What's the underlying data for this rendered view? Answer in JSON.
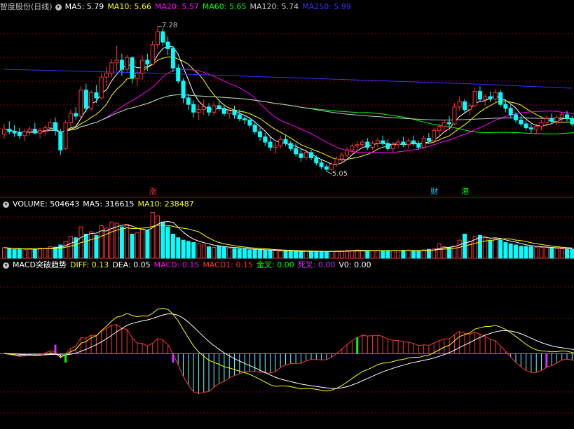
{
  "price_header": {
    "stock": "智度股份(日线)",
    "items": [
      {
        "label": "MA5: 5.79",
        "color": "#ffffff"
      },
      {
        "label": "MA10: 5.66",
        "color": "#ffff00"
      },
      {
        "label": "MA20: 5.57",
        "color": "#ff00ff"
      },
      {
        "label": "MA60: 5.65",
        "color": "#00ff00"
      },
      {
        "label": "MA120: 5.74",
        "color": "#c8c8c8"
      },
      {
        "label": "MA250: 5.99",
        "color": "#3333ff"
      }
    ]
  },
  "volume_header": {
    "items": [
      {
        "label": "VOLUME: 504643",
        "color": "#ffffff"
      },
      {
        "label": "MA5: 316615",
        "color": "#ffffff"
      },
      {
        "label": "MA10: 238487",
        "color": "#ffff00"
      }
    ]
  },
  "macd_header": {
    "name": "MACD突破趋势",
    "items": [
      {
        "label": "DIFF: 0.13",
        "color": "#ffff00"
      },
      {
        "label": "DEA: 0.05",
        "color": "#ffffff"
      },
      {
        "label": "MACD: 0.15",
        "color": "#ff00ff"
      },
      {
        "label": "MACD1: 0.15",
        "color": "#ff3333"
      },
      {
        "label": "金叉: 0.00",
        "color": "#00ff00"
      },
      {
        "label": "死叉: 0.00",
        "color": "#cc33ff"
      },
      {
        "label": "V0: 0.00",
        "color": "#ffffff"
      }
    ]
  },
  "annotations": {
    "high": "7.28",
    "low": "5.05"
  },
  "events": [
    {
      "label": "涨",
      "color": "#ff3333",
      "index": 29
    },
    {
      "label": "财",
      "color": "#00ccff",
      "index": 84
    },
    {
      "label": "港",
      "color": "#00ff00",
      "index": 90
    }
  ],
  "colors": {
    "up": "#ff3333",
    "down": "#00ffff",
    "grid": "#8b0000",
    "ma250": "#3333ff"
  },
  "chart_data": [
    {
      "type": "candlestick",
      "panel": "price",
      "ylim": [
        4.8,
        7.45
      ],
      "grid": true,
      "candles": [
        {
          "o": 5.62,
          "h": 5.78,
          "l": 5.55,
          "c": 5.7
        },
        {
          "o": 5.7,
          "h": 5.82,
          "l": 5.62,
          "c": 5.66
        },
        {
          "o": 5.66,
          "h": 5.76,
          "l": 5.58,
          "c": 5.64
        },
        {
          "o": 5.64,
          "h": 5.72,
          "l": 5.55,
          "c": 5.6
        },
        {
          "o": 5.6,
          "h": 5.7,
          "l": 5.52,
          "c": 5.66
        },
        {
          "o": 5.66,
          "h": 5.74,
          "l": 5.6,
          "c": 5.7
        },
        {
          "o": 5.7,
          "h": 5.8,
          "l": 5.62,
          "c": 5.64
        },
        {
          "o": 5.64,
          "h": 5.72,
          "l": 5.56,
          "c": 5.68
        },
        {
          "o": 5.68,
          "h": 5.76,
          "l": 5.6,
          "c": 5.72
        },
        {
          "o": 5.72,
          "h": 5.86,
          "l": 5.66,
          "c": 5.8
        },
        {
          "o": 5.8,
          "h": 5.88,
          "l": 5.6,
          "c": 5.68
        },
        {
          "o": 5.66,
          "h": 5.7,
          "l": 5.3,
          "c": 5.38
        },
        {
          "o": 5.4,
          "h": 5.84,
          "l": 5.38,
          "c": 5.8
        },
        {
          "o": 5.8,
          "h": 6.0,
          "l": 5.74,
          "c": 5.94
        },
        {
          "o": 5.94,
          "h": 6.04,
          "l": 5.84,
          "c": 5.9
        },
        {
          "o": 5.9,
          "h": 6.36,
          "l": 5.88,
          "c": 6.3
        },
        {
          "o": 6.3,
          "h": 6.4,
          "l": 5.96,
          "c": 6.02
        },
        {
          "o": 6.02,
          "h": 6.3,
          "l": 5.98,
          "c": 6.26
        },
        {
          "o": 6.26,
          "h": 6.38,
          "l": 6.1,
          "c": 6.18
        },
        {
          "o": 6.18,
          "h": 6.56,
          "l": 6.16,
          "c": 6.5
        },
        {
          "o": 6.5,
          "h": 6.66,
          "l": 6.36,
          "c": 6.56
        },
        {
          "o": 6.56,
          "h": 6.78,
          "l": 6.5,
          "c": 6.72
        },
        {
          "o": 6.72,
          "h": 6.98,
          "l": 6.6,
          "c": 6.76
        },
        {
          "o": 6.76,
          "h": 6.86,
          "l": 6.52,
          "c": 6.62
        },
        {
          "o": 6.62,
          "h": 6.84,
          "l": 6.58,
          "c": 6.8
        },
        {
          "o": 6.8,
          "h": 6.82,
          "l": 6.4,
          "c": 6.48
        },
        {
          "o": 6.48,
          "h": 6.62,
          "l": 6.36,
          "c": 6.56
        },
        {
          "o": 6.56,
          "h": 6.84,
          "l": 6.46,
          "c": 6.76
        },
        {
          "o": 6.76,
          "h": 6.86,
          "l": 6.6,
          "c": 6.7
        },
        {
          "o": 6.7,
          "h": 7.06,
          "l": 6.68,
          "c": 7.0
        },
        {
          "o": 7.0,
          "h": 7.28,
          "l": 6.94,
          "c": 7.2
        },
        {
          "o": 7.2,
          "h": 7.26,
          "l": 6.98,
          "c": 7.04
        },
        {
          "o": 7.04,
          "h": 7.12,
          "l": 6.84,
          "c": 6.94
        },
        {
          "o": 6.94,
          "h": 6.98,
          "l": 6.58,
          "c": 6.64
        },
        {
          "o": 6.64,
          "h": 6.7,
          "l": 6.4,
          "c": 6.44
        },
        {
          "o": 6.44,
          "h": 6.48,
          "l": 6.1,
          "c": 6.18
        },
        {
          "o": 6.18,
          "h": 6.24,
          "l": 6.0,
          "c": 6.08
        },
        {
          "o": 6.08,
          "h": 6.14,
          "l": 5.88,
          "c": 5.96
        },
        {
          "o": 5.96,
          "h": 6.08,
          "l": 5.84,
          "c": 6.0
        },
        {
          "o": 6.0,
          "h": 6.16,
          "l": 5.92,
          "c": 6.04
        },
        {
          "o": 6.04,
          "h": 6.1,
          "l": 5.9,
          "c": 5.96
        },
        {
          "o": 5.96,
          "h": 6.12,
          "l": 5.9,
          "c": 6.06
        },
        {
          "o": 6.06,
          "h": 6.16,
          "l": 5.98,
          "c": 6.02
        },
        {
          "o": 6.02,
          "h": 6.08,
          "l": 5.9,
          "c": 5.94
        },
        {
          "o": 5.94,
          "h": 6.04,
          "l": 5.86,
          "c": 5.98
        },
        {
          "o": 5.98,
          "h": 6.06,
          "l": 5.86,
          "c": 5.92
        },
        {
          "o": 5.92,
          "h": 6.0,
          "l": 5.82,
          "c": 5.86
        },
        {
          "o": 5.86,
          "h": 5.92,
          "l": 5.78,
          "c": 5.84
        },
        {
          "o": 5.84,
          "h": 5.88,
          "l": 5.72,
          "c": 5.76
        },
        {
          "o": 5.76,
          "h": 5.82,
          "l": 5.62,
          "c": 5.66
        },
        {
          "o": 5.66,
          "h": 5.72,
          "l": 5.52,
          "c": 5.58
        },
        {
          "o": 5.58,
          "h": 5.64,
          "l": 5.44,
          "c": 5.5
        },
        {
          "o": 5.5,
          "h": 5.58,
          "l": 5.36,
          "c": 5.42
        },
        {
          "o": 5.42,
          "h": 5.5,
          "l": 5.32,
          "c": 5.44
        },
        {
          "o": 5.44,
          "h": 5.6,
          "l": 5.4,
          "c": 5.54
        },
        {
          "o": 5.54,
          "h": 5.62,
          "l": 5.44,
          "c": 5.48
        },
        {
          "o": 5.48,
          "h": 5.52,
          "l": 5.36,
          "c": 5.4
        },
        {
          "o": 5.4,
          "h": 5.48,
          "l": 5.28,
          "c": 5.32
        },
        {
          "o": 5.32,
          "h": 5.4,
          "l": 5.2,
          "c": 5.26
        },
        {
          "o": 5.26,
          "h": 5.4,
          "l": 5.22,
          "c": 5.34
        },
        {
          "o": 5.34,
          "h": 5.38,
          "l": 5.22,
          "c": 5.26
        },
        {
          "o": 5.26,
          "h": 5.3,
          "l": 5.14,
          "c": 5.18
        },
        {
          "o": 5.18,
          "h": 5.24,
          "l": 5.08,
          "c": 5.12
        },
        {
          "o": 5.12,
          "h": 5.16,
          "l": 5.05,
          "c": 5.08
        },
        {
          "o": 5.08,
          "h": 5.2,
          "l": 5.06,
          "c": 5.16
        },
        {
          "o": 5.16,
          "h": 5.28,
          "l": 5.12,
          "c": 5.24
        },
        {
          "o": 5.24,
          "h": 5.34,
          "l": 5.18,
          "c": 5.3
        },
        {
          "o": 5.3,
          "h": 5.42,
          "l": 5.26,
          "c": 5.38
        },
        {
          "o": 5.38,
          "h": 5.48,
          "l": 5.32,
          "c": 5.44
        },
        {
          "o": 5.44,
          "h": 5.52,
          "l": 5.36,
          "c": 5.46
        },
        {
          "o": 5.46,
          "h": 5.54,
          "l": 5.4,
          "c": 5.5
        },
        {
          "o": 5.5,
          "h": 5.56,
          "l": 5.38,
          "c": 5.42
        },
        {
          "o": 5.42,
          "h": 5.52,
          "l": 5.38,
          "c": 5.48
        },
        {
          "o": 5.48,
          "h": 5.56,
          "l": 5.42,
          "c": 5.52
        },
        {
          "o": 5.52,
          "h": 5.6,
          "l": 5.44,
          "c": 5.48
        },
        {
          "o": 5.48,
          "h": 5.54,
          "l": 5.36,
          "c": 5.4
        },
        {
          "o": 5.4,
          "h": 5.5,
          "l": 5.34,
          "c": 5.46
        },
        {
          "o": 5.46,
          "h": 5.54,
          "l": 5.4,
          "c": 5.5
        },
        {
          "o": 5.5,
          "h": 5.58,
          "l": 5.42,
          "c": 5.46
        },
        {
          "o": 5.46,
          "h": 5.56,
          "l": 5.4,
          "c": 5.52
        },
        {
          "o": 5.52,
          "h": 5.6,
          "l": 5.44,
          "c": 5.48
        },
        {
          "o": 5.48,
          "h": 5.52,
          "l": 5.38,
          "c": 5.42
        },
        {
          "o": 5.42,
          "h": 5.6,
          "l": 5.4,
          "c": 5.56
        },
        {
          "o": 5.56,
          "h": 5.64,
          "l": 5.48,
          "c": 5.52
        },
        {
          "o": 5.52,
          "h": 5.72,
          "l": 5.5,
          "c": 5.68
        },
        {
          "o": 5.68,
          "h": 5.78,
          "l": 5.6,
          "c": 5.74
        },
        {
          "o": 5.74,
          "h": 5.84,
          "l": 5.66,
          "c": 5.8
        },
        {
          "o": 5.8,
          "h": 5.9,
          "l": 5.72,
          "c": 5.78
        },
        {
          "o": 5.78,
          "h": 6.1,
          "l": 5.76,
          "c": 6.04
        },
        {
          "o": 6.04,
          "h": 6.2,
          "l": 5.98,
          "c": 6.12
        },
        {
          "o": 6.12,
          "h": 6.16,
          "l": 5.96,
          "c": 6.0
        },
        {
          "o": 6.0,
          "h": 6.1,
          "l": 5.92,
          "c": 6.06
        },
        {
          "o": 6.06,
          "h": 6.34,
          "l": 6.04,
          "c": 6.28
        },
        {
          "o": 6.28,
          "h": 6.36,
          "l": 6.12,
          "c": 6.16
        },
        {
          "o": 6.16,
          "h": 6.24,
          "l": 6.06,
          "c": 6.2
        },
        {
          "o": 6.2,
          "h": 6.28,
          "l": 6.12,
          "c": 6.16
        },
        {
          "o": 6.16,
          "h": 6.32,
          "l": 6.1,
          "c": 6.26
        },
        {
          "o": 6.26,
          "h": 6.3,
          "l": 6.04,
          "c": 6.08
        },
        {
          "o": 6.08,
          "h": 6.16,
          "l": 5.96,
          "c": 6.02
        },
        {
          "o": 6.02,
          "h": 6.08,
          "l": 5.88,
          "c": 5.92
        },
        {
          "o": 5.92,
          "h": 5.96,
          "l": 5.8,
          "c": 5.84
        },
        {
          "o": 5.84,
          "h": 5.9,
          "l": 5.74,
          "c": 5.78
        },
        {
          "o": 5.78,
          "h": 5.84,
          "l": 5.68,
          "c": 5.72
        },
        {
          "o": 5.72,
          "h": 5.78,
          "l": 5.64,
          "c": 5.7
        },
        {
          "o": 5.7,
          "h": 5.78,
          "l": 5.62,
          "c": 5.74
        },
        {
          "o": 5.74,
          "h": 5.84,
          "l": 5.68,
          "c": 5.8
        },
        {
          "o": 5.8,
          "h": 5.9,
          "l": 5.74,
          "c": 5.86
        },
        {
          "o": 5.86,
          "h": 5.94,
          "l": 5.78,
          "c": 5.82
        },
        {
          "o": 5.82,
          "h": 5.92,
          "l": 5.76,
          "c": 5.88
        },
        {
          "o": 5.88,
          "h": 5.96,
          "l": 5.8,
          "c": 5.92
        },
        {
          "o": 5.92,
          "h": 5.98,
          "l": 5.82,
          "c": 5.86
        },
        {
          "o": 5.86,
          "h": 5.9,
          "l": 5.74,
          "c": 5.78
        },
        {
          "o": 5.78,
          "h": 5.82,
          "l": 5.68,
          "c": 5.72
        },
        {
          "o": 5.72,
          "h": 5.78,
          "l": 5.64,
          "c": 5.66
        },
        {
          "o": 5.66,
          "h": 5.72,
          "l": 5.6,
          "c": 5.64
        },
        {
          "o": 5.64,
          "h": 5.7,
          "l": 5.58,
          "c": 5.6
        },
        {
          "o": 5.6,
          "h": 5.66,
          "l": 5.56,
          "c": 5.62
        }
      ],
      "ma": [
        {
          "name": "MA5",
          "period": 5,
          "color": "#ffffff"
        },
        {
          "name": "MA10",
          "period": 10,
          "color": "#ffff00"
        },
        {
          "name": "MA20",
          "period": 20,
          "color": "#ff00ff"
        },
        {
          "name": "MA60",
          "period": 60,
          "color": "#00ff00"
        },
        {
          "name": "MA120",
          "period": 120,
          "color": "#c8c8c8"
        },
        {
          "name": "MA250",
          "color": "#3333ff",
          "points": [
            [
              0,
              6.62
            ],
            [
              30,
              6.56
            ],
            [
              60,
              6.48
            ],
            [
              90,
              6.4
            ],
            [
              111,
              6.33
            ]
          ]
        }
      ]
    },
    {
      "type": "bar",
      "panel": "volume",
      "values": [
        88,
        80,
        72,
        78,
        70,
        80,
        76,
        84,
        82,
        96,
        92,
        110,
        140,
        180,
        170,
        260,
        200,
        220,
        190,
        270,
        250,
        300,
        290,
        260,
        280,
        200,
        210,
        240,
        230,
        380,
        350,
        300,
        260,
        200,
        170,
        150,
        140,
        130,
        120,
        110,
        95,
        90,
        100,
        92,
        85,
        80,
        78,
        76,
        70,
        72,
        68,
        66,
        64,
        62,
        60,
        58,
        60,
        56,
        54,
        58,
        60,
        56,
        54,
        52,
        58,
        60,
        62,
        66,
        64,
        68,
        64,
        60,
        62,
        66,
        64,
        60,
        62,
        64,
        66,
        68,
        62,
        60,
        70,
        74,
        78,
        120,
        96,
        90,
        100,
        150,
        200,
        140,
        180,
        190,
        170,
        150,
        160,
        150,
        130,
        120,
        110,
        100,
        98,
        96,
        92,
        90,
        88,
        84,
        80,
        78,
        74,
        76
      ],
      "ylim": [
        0,
        400
      ],
      "ma": [
        {
          "name": "MA5",
          "period": 5,
          "color": "#ffffff"
        },
        {
          "name": "MA10",
          "period": 10,
          "color": "#ffff00"
        }
      ]
    },
    {
      "type": "macd",
      "panel": "macd",
      "ylim": [
        -0.5,
        0.55
      ],
      "diff_color": "#ffff00",
      "dea_color": "#ffffff",
      "macd_up_color": "#ff3333",
      "macd_down_color": "#66ffff",
      "golden_cross_color": "#00ff00",
      "death_cross_color": "#cc33ff",
      "golden_cross_index": [
        12,
        69,
        114
      ],
      "death_cross_index": [
        10,
        33,
        106
      ]
    }
  ]
}
